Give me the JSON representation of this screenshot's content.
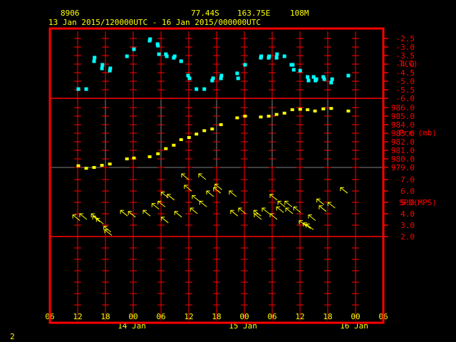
{
  "header": {
    "station_id": "8906",
    "latitude": "77.44S",
    "longitude": "163.75E",
    "elevation": "108M",
    "time_range": "13 Jan 2015/120000UTC - 16 Jan 2015/000000UTC"
  },
  "page_number": "2",
  "colors": {
    "frame": "#ff0000",
    "text": "#ffff00",
    "temperature": "#00ffff",
    "pressure": "#ffff00",
    "wind": "#ffff00",
    "grid_minor": "#808080"
  },
  "chart_data": [
    {
      "type": "scatter",
      "title": "T(C)",
      "ylabel": "T(C)",
      "ylim": [
        -6.0,
        -2.5
      ],
      "yticks": [
        "-2.5",
        "-3.0",
        "-3.5",
        "-4.0",
        "-4.5",
        "-5.0",
        "-5.5",
        "-6.0"
      ],
      "x_units": "hours since 13 Jan 2015 12UTC",
      "points": [
        [
          0.3,
          -5.46
        ],
        [
          2.0,
          -5.46
        ],
        [
          3.7,
          -3.83
        ],
        [
          3.8,
          -3.62
        ],
        [
          5.4,
          -4.25
        ],
        [
          5.5,
          -4.04
        ],
        [
          7.1,
          -4.38
        ],
        [
          7.2,
          -4.25
        ],
        [
          10.8,
          -3.54
        ],
        [
          12.3,
          -3.13
        ],
        [
          15.7,
          -2.63
        ],
        [
          15.8,
          -2.54
        ],
        [
          17.4,
          -2.83
        ],
        [
          17.5,
          -2.92
        ],
        [
          17.7,
          -3.42
        ],
        [
          19.2,
          -3.42
        ],
        [
          19.4,
          -3.54
        ],
        [
          20.9,
          -3.63
        ],
        [
          21.1,
          -3.54
        ],
        [
          22.5,
          -3.83
        ],
        [
          24.0,
          -4.67
        ],
        [
          24.3,
          -4.83
        ],
        [
          25.8,
          -5.46
        ],
        [
          27.5,
          -5.46
        ],
        [
          29.2,
          -4.96
        ],
        [
          29.4,
          -4.83
        ],
        [
          31.1,
          -4.83
        ],
        [
          31.2,
          -4.67
        ],
        [
          34.6,
          -4.54
        ],
        [
          34.8,
          -4.83
        ],
        [
          36.3,
          -4.04
        ],
        [
          39.7,
          -3.63
        ],
        [
          39.8,
          -3.54
        ],
        [
          41.4,
          -3.63
        ],
        [
          41.5,
          -3.54
        ],
        [
          43.1,
          -3.63
        ],
        [
          43.2,
          -3.42
        ],
        [
          44.8,
          -3.54
        ],
        [
          46.3,
          -4.04
        ],
        [
          46.6,
          -4.04
        ],
        [
          46.8,
          -4.33
        ],
        [
          48.2,
          -4.38
        ],
        [
          49.8,
          -4.75
        ],
        [
          50.0,
          -4.96
        ],
        [
          51.1,
          -4.75
        ],
        [
          51.5,
          -4.96
        ],
        [
          51.7,
          -4.88
        ],
        [
          53.2,
          -4.75
        ],
        [
          53.4,
          -4.88
        ],
        [
          54.9,
          -5.08
        ],
        [
          55.1,
          -4.88
        ],
        [
          58.6,
          -4.67
        ]
      ]
    },
    {
      "type": "scatter",
      "title": "Pre (mb)",
      "ylabel": "Pre (mb)",
      "ylim": [
        979.0,
        986.0
      ],
      "yticks": [
        "986.0",
        "985.0",
        "984.0",
        "983.0",
        "982.0",
        "981.0",
        "980.0",
        "979.0"
      ],
      "points": [
        [
          0.3,
          979.2
        ],
        [
          2.0,
          978.9
        ],
        [
          3.7,
          979.0
        ],
        [
          5.4,
          979.25
        ],
        [
          7.1,
          979.4
        ],
        [
          10.8,
          980.0
        ],
        [
          12.3,
          980.1
        ],
        [
          15.7,
          980.25
        ],
        [
          17.5,
          980.6
        ],
        [
          19.2,
          981.2
        ],
        [
          20.9,
          981.6
        ],
        [
          22.5,
          982.25
        ],
        [
          24.2,
          982.5
        ],
        [
          25.8,
          982.9
        ],
        [
          27.5,
          983.3
        ],
        [
          29.2,
          983.5
        ],
        [
          31.1,
          984.0
        ],
        [
          34.6,
          984.8
        ],
        [
          36.3,
          985.0
        ],
        [
          39.7,
          984.9
        ],
        [
          41.4,
          985.0
        ],
        [
          43.1,
          985.2
        ],
        [
          44.8,
          985.35
        ],
        [
          46.5,
          985.75
        ],
        [
          48.2,
          985.8
        ],
        [
          49.8,
          985.75
        ],
        [
          51.4,
          985.6
        ],
        [
          53.2,
          985.85
        ],
        [
          54.9,
          985.9
        ],
        [
          58.6,
          985.6
        ]
      ]
    },
    {
      "type": "vector",
      "title": "SPD(MPS)",
      "ylabel": "SPD(MPS)",
      "ylim": [
        2.0,
        7.0
      ],
      "yticks": [
        "7.0",
        "6.0",
        "5.0",
        "4.0",
        "3.0",
        "2.0"
      ],
      "direction": "arrows pointing toward upper-left",
      "points": [
        [
          -0.9,
          3.9
        ],
        [
          0.6,
          4.0
        ],
        [
          3.1,
          4.0
        ],
        [
          3.4,
          3.8
        ],
        [
          4.2,
          3.6
        ],
        [
          5.8,
          2.9
        ],
        [
          6.0,
          2.6
        ],
        [
          9.4,
          4.3
        ],
        [
          11.1,
          4.2
        ],
        [
          14.3,
          4.3
        ],
        [
          16.2,
          4.9
        ],
        [
          17.5,
          5.1
        ],
        [
          18.2,
          3.7
        ],
        [
          18.2,
          5.9
        ],
        [
          19.5,
          5.7
        ],
        [
          21.1,
          4.2
        ],
        [
          22.6,
          7.5
        ],
        [
          23.2,
          6.5
        ],
        [
          24.5,
          4.5
        ],
        [
          24.9,
          5.6
        ],
        [
          26.3,
          7.5
        ],
        [
          26.5,
          5.1
        ],
        [
          28.0,
          6.0
        ],
        [
          29.5,
          6.3
        ],
        [
          29.8,
          6.6
        ],
        [
          32.9,
          6.0
        ],
        [
          33.2,
          4.3
        ],
        [
          34.9,
          4.5
        ],
        [
          38.2,
          4.3
        ],
        [
          38.3,
          4.0
        ],
        [
          40.0,
          4.5
        ],
        [
          41.7,
          5.7
        ],
        [
          41.7,
          4.0
        ],
        [
          43.4,
          5.1
        ],
        [
          43.1,
          4.6
        ],
        [
          44.9,
          5.1
        ],
        [
          45.1,
          4.5
        ],
        [
          46.8,
          4.6
        ],
        [
          48.0,
          3.4
        ],
        [
          48.9,
          3.2
        ],
        [
          49.5,
          3.1
        ],
        [
          50.0,
          3.9
        ],
        [
          51.8,
          5.3
        ],
        [
          52.3,
          4.7
        ],
        [
          54.2,
          5.0
        ],
        [
          56.9,
          6.3
        ]
      ]
    }
  ],
  "x_axis": {
    "tick_labels": [
      "06",
      "12",
      "18",
      "00",
      "06",
      "12",
      "18",
      "00",
      "06",
      "12",
      "18",
      "00",
      "06"
    ],
    "date_labels": [
      "14 Jan",
      "15 Jan",
      "16 Jan"
    ]
  }
}
